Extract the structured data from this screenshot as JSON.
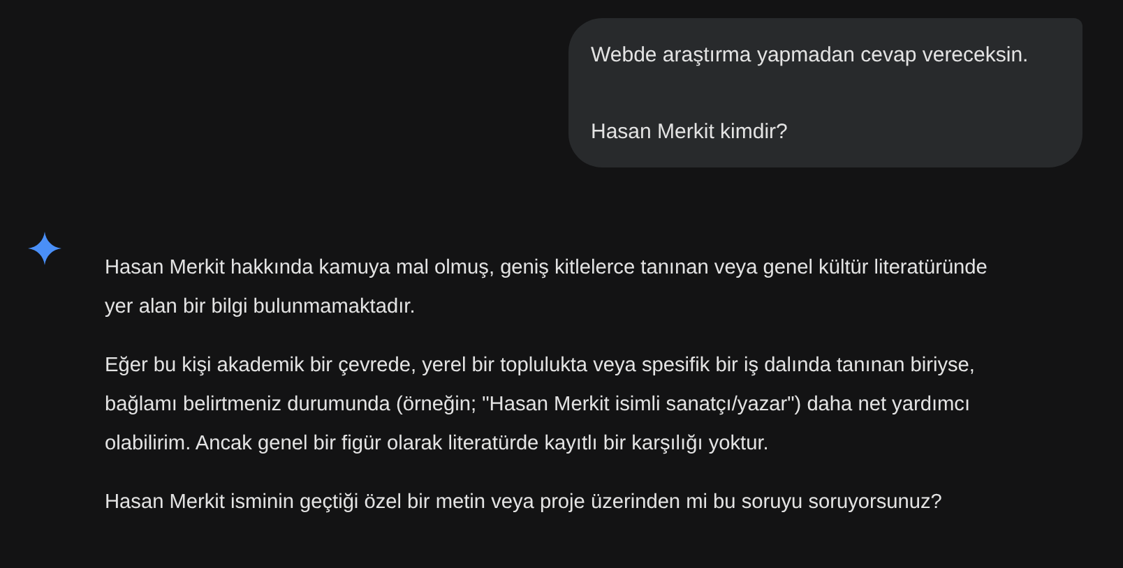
{
  "conversation": [
    {
      "kind": "user",
      "paragraphs": [
        "Webde araştırma yapmadan cevap vereceksin.",
        "Hasan Merkit kimdir?"
      ]
    },
    {
      "kind": "assistant",
      "paragraphs": [
        "Hasan Merkit hakkında kamuya mal olmuş, geniş kitlelerce tanınan veya genel kültür literatüründe yer alan bir bilgi bulunmamaktadır.",
        "Eğer bu kişi akademik bir çevrede, yerel bir toplulukta veya spesifik bir iş dalında tanınan biriyse, bağlamı belirtmeniz durumunda (örneğin; \"Hasan Merkit isimli sanatçı/yazar\") daha net yardımcı olabilirim. Ancak genel bir figür olarak literatürde kayıtlı bir karşılığı yoktur.",
        "Hasan Merkit isminin geçtiği özel bir metin veya proje üzerinden mi bu soruyu soruyorsunuz?"
      ]
    }
  ]
}
